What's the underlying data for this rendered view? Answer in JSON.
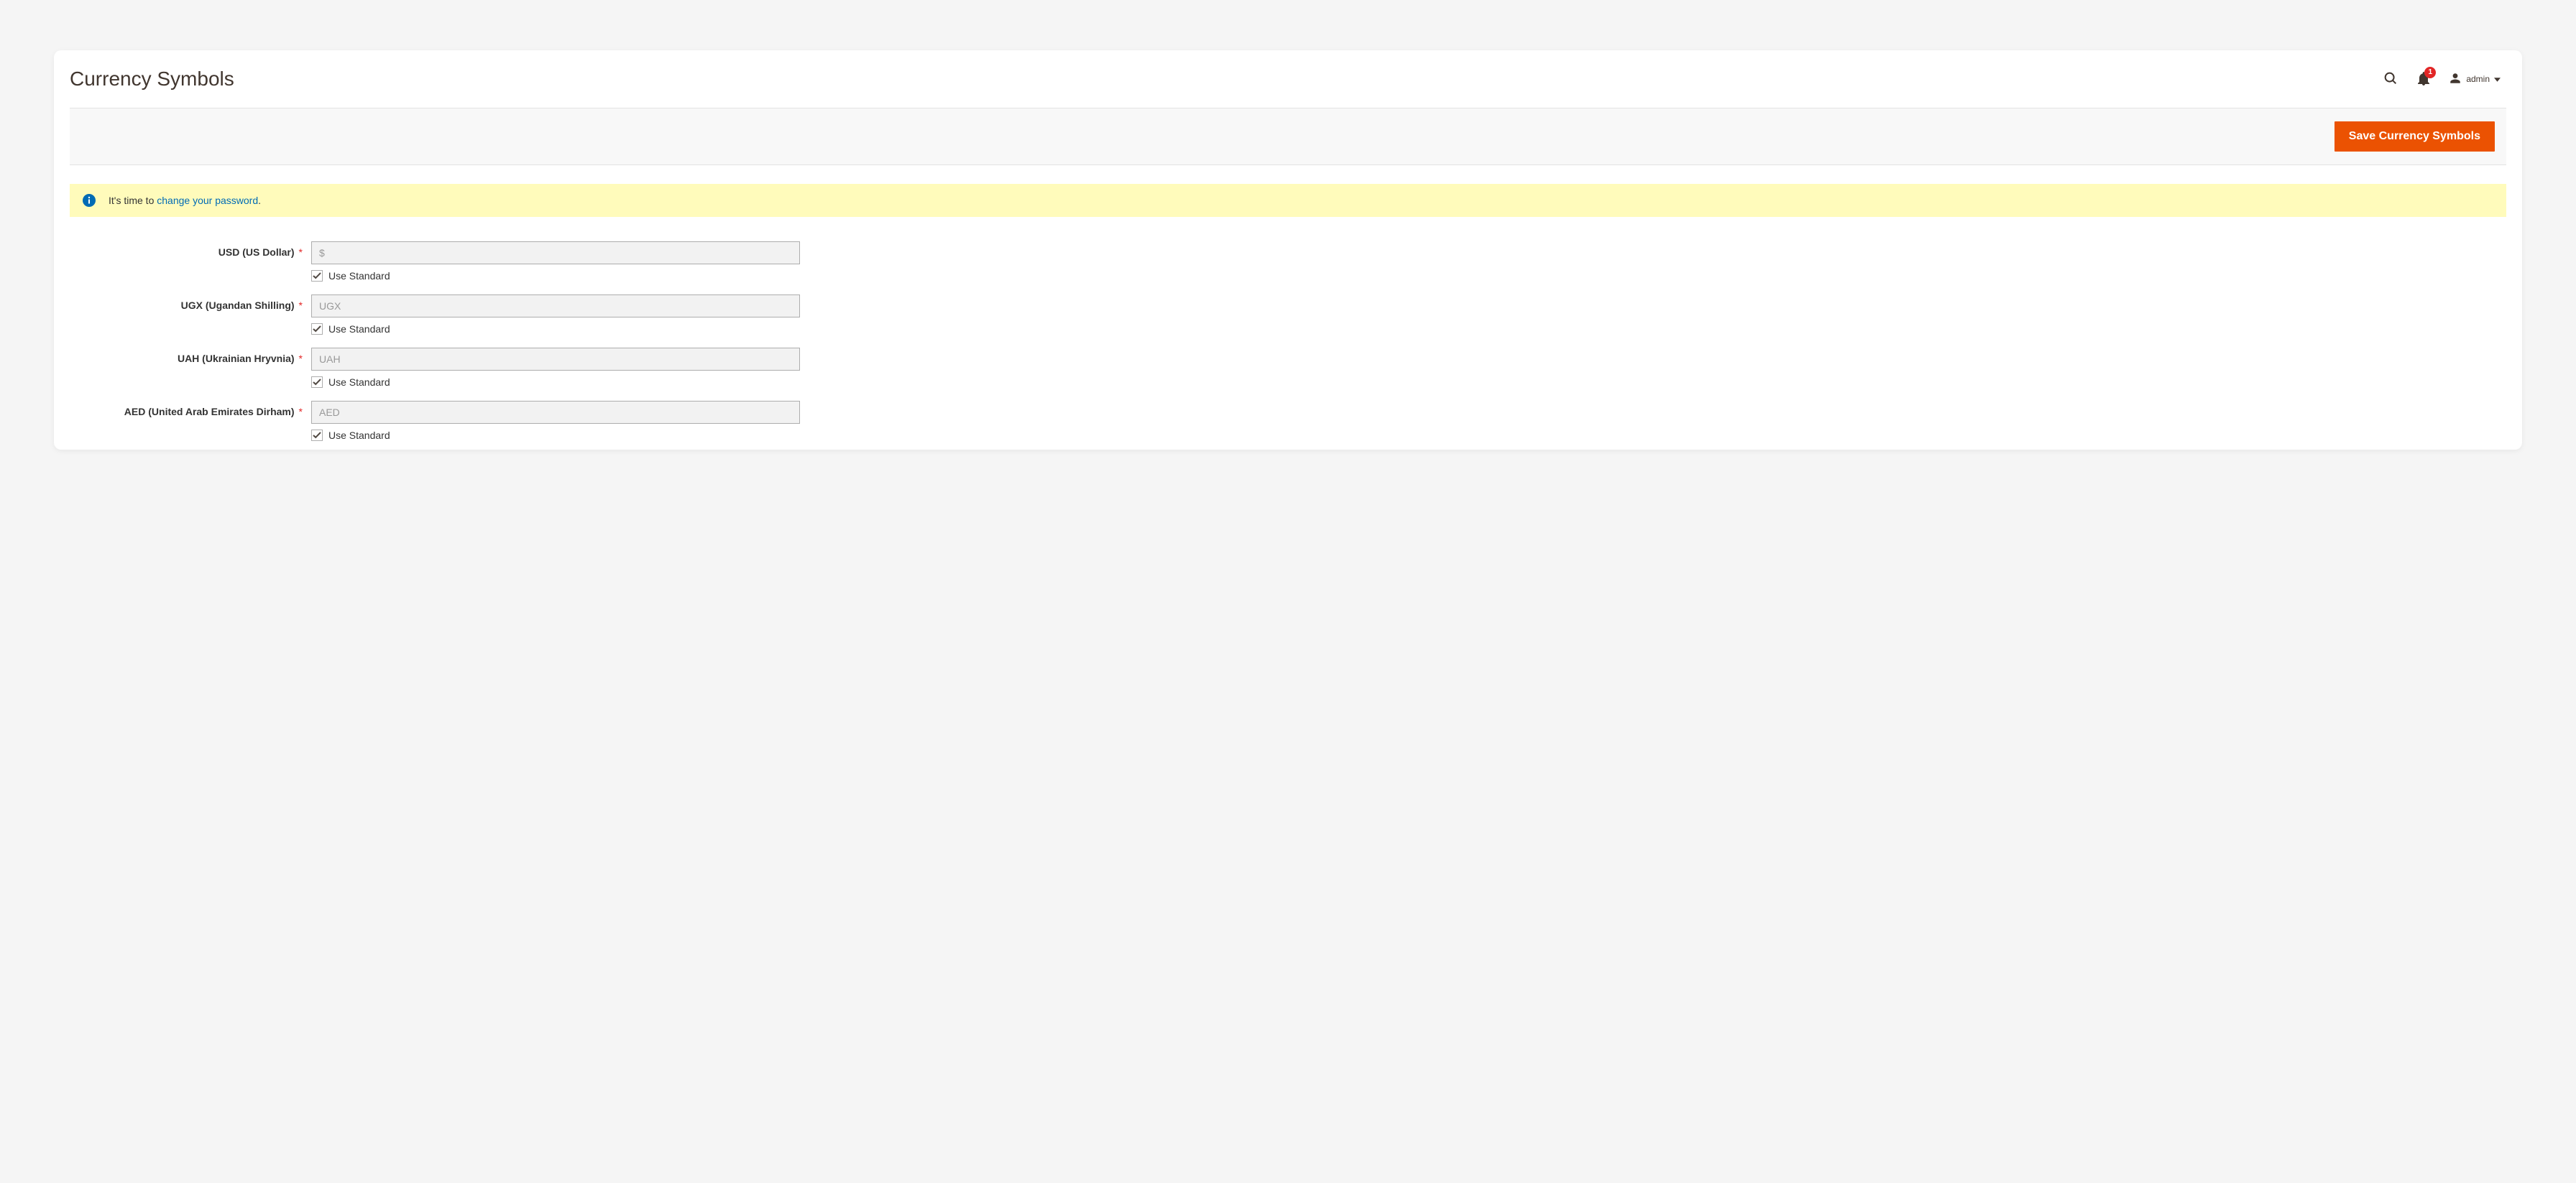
{
  "header": {
    "title": "Currency Symbols",
    "username": "admin",
    "notification_count": "1"
  },
  "toolbar": {
    "save_label": "Save Currency Symbols"
  },
  "notice": {
    "prefix": "It's time to ",
    "link": "change your password",
    "suffix": "."
  },
  "use_standard_label": "Use Standard",
  "currencies": [
    {
      "label": "USD (US Dollar)",
      "value": "$",
      "use_standard": true
    },
    {
      "label": "UGX (Ugandan Shilling)",
      "value": "UGX",
      "use_standard": true
    },
    {
      "label": "UAH (Ukrainian Hryvnia)",
      "value": "UAH",
      "use_standard": true
    },
    {
      "label": "AED (United Arab Emirates Dirham)",
      "value": "AED",
      "use_standard": true
    }
  ]
}
